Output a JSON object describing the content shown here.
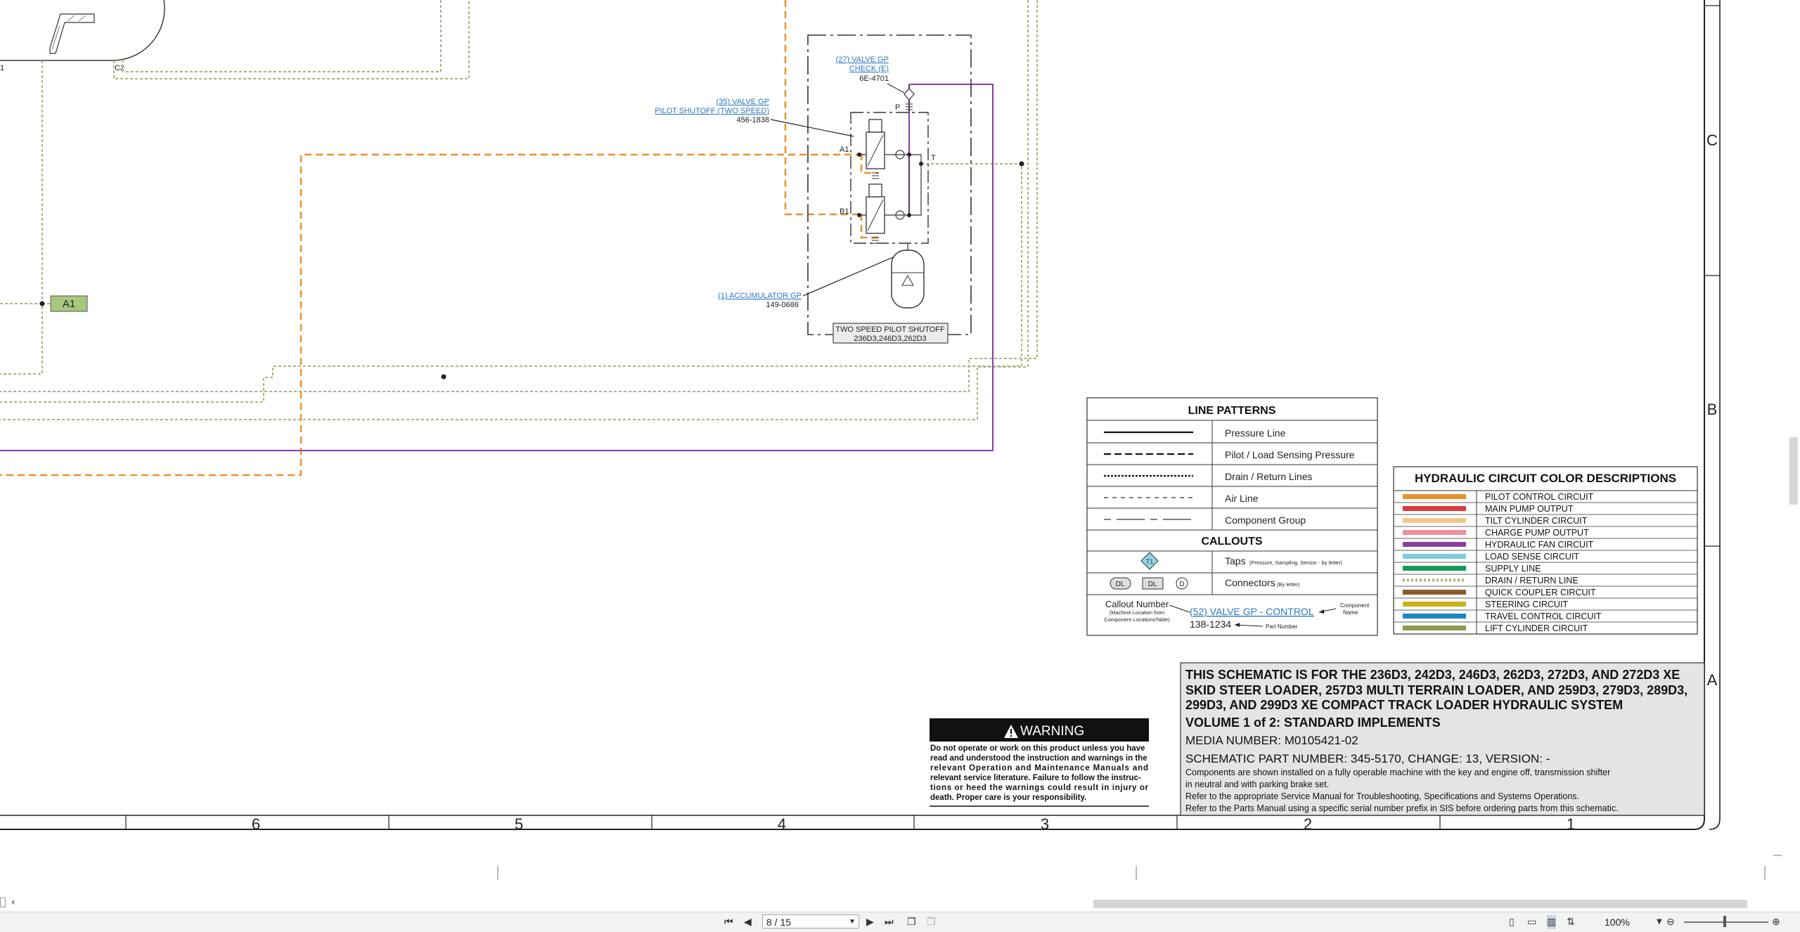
{
  "schematic": {
    "tag_a1": "A1",
    "tag_c1": "1",
    "tag_c2": "C2",
    "valve_check": {
      "line1": "(27) VALVE GP",
      "line2": "CHECK (E)",
      "part": "6E-4701"
    },
    "valve_pilot": {
      "line1": "(35) VALVE GP",
      "line2": "PILOT SHUTOFF (TWO SPEED)",
      "part": "456-1838"
    },
    "accumulator": {
      "line1": "(1) ACCUMULATOR GP",
      "part": "149-0686"
    },
    "port_p": "P",
    "port_t": "T",
    "port_a1": "A1",
    "port_b1": "B1",
    "group_label": {
      "line1": "TWO SPEED PILOT SHUTOFF",
      "line2": "236D3,246D3,262D3"
    }
  },
  "line_patterns": {
    "title": "LINE PATTERNS",
    "rows": [
      "Pressure Line",
      "Pilot / Load Sensing Pressure",
      "Drain / Return Lines",
      "Air Line",
      "Component Group"
    ]
  },
  "callouts": {
    "title": "CALLOUTS",
    "taps_label": "Taps",
    "taps_note": "(Pressure, Sampling, Sensor - by letter)",
    "tap_symbol": "T1",
    "connectors_label": "Connectors",
    "connectors_note": "(By letter)",
    "connector_symbols": [
      "DL",
      "DL",
      "D"
    ],
    "callout_number": "Callout Number",
    "callout_note1": "(Machine Location from",
    "callout_note2": "Component LocationsTable)",
    "example_link": "(52) VALVE GP - CONTROL",
    "example_part": "138-1234",
    "component_name1": "Component",
    "component_name2": "Name",
    "part_number": "Part Number"
  },
  "color_table": {
    "title": "HYDRAULIC CIRCUIT COLOR DESCRIPTIONS",
    "rows": [
      {
        "label": "PILOT CONTROL CIRCUIT",
        "color": "#e8912d"
      },
      {
        "label": "MAIN PUMP OUTPUT",
        "color": "#e0393a"
      },
      {
        "label": "TILT CYLINDER CIRCUIT",
        "color": "#f6c58e"
      },
      {
        "label": "CHARGE PUMP OUTPUT",
        "color": "#ef8fa0"
      },
      {
        "label": "HYDRAULIC FAN CIRCUIT",
        "color": "#8a3fa2"
      },
      {
        "label": "LOAD SENSE CIRCUIT",
        "color": "#7ecbe0"
      },
      {
        "label": "SUPPLY LINE",
        "color": "#139a55"
      },
      {
        "label": "DRAIN / RETURN LINE",
        "color": "#a9b37c"
      },
      {
        "label": "QUICK COUPLER CIRCUIT",
        "color": "#8a5a2a"
      },
      {
        "label": "STEERING CIRCUIT",
        "color": "#c8b41a"
      },
      {
        "label": "TRAVEL CONTROL CIRCUIT",
        "color": "#1a86c2"
      },
      {
        "label": "LIFT CYLINDER CIRCUIT",
        "color": "#8f9a52"
      }
    ]
  },
  "warning": {
    "title": "WARNING",
    "lines": [
      "Do not operate or work on this product unless you have",
      "read and understood the instruction and warnings in the",
      "relevant Operation and Maintenance Manuals and",
      "relevant service literature. Failure to follow the instruc-",
      "tions or heed the warnings could result in injury or",
      "death. Proper care is your responsibility."
    ]
  },
  "title_block": {
    "line1": "THIS SCHEMATIC IS FOR THE 236D3, 242D3, 246D3, 262D3, 272D3, AND 272D3 XE",
    "line2": "SKID STEER LOADER, 257D3 MULTI TERRAIN LOADER, AND 259D3, 279D3, 289D3,",
    "line3": "299D3, AND 299D3 XE COMPACT TRACK LOADER HYDRAULIC SYSTEM",
    "volume": "VOLUME 1 of 2: STANDARD IMPLEMENTS",
    "media": "MEDIA NUMBER: M0105421-02",
    "part": "SCHEMATIC PART NUMBER: 345-5170, CHANGE: 13, VERSION: -",
    "notes": [
      "Components are shown installed on a fully operable machine with the key and engine off, transmission shifter",
      "in neutral and with parking brake set.",
      "Refer to the appropriate Service Manual for Troubleshooting, Specifications and Systems Operations.",
      "Refer to the Parts Manual using a specific serial number prefix in SIS before ordering parts from this schematic."
    ]
  },
  "grid": {
    "columns": [
      "6",
      "5",
      "4",
      "3",
      "2",
      "1"
    ],
    "rows": [
      "C",
      "B",
      "A"
    ]
  },
  "viewer": {
    "page_value": "8 / 15",
    "zoom": "100%",
    "colors": {
      "toolbar": "#f2f2f2",
      "accent": "#2a78c2"
    }
  }
}
